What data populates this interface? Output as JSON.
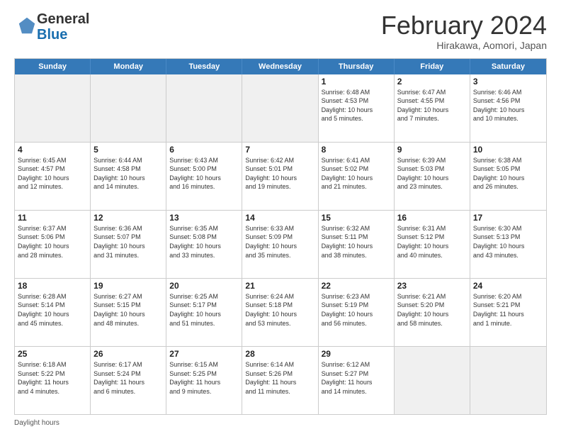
{
  "header": {
    "logo_line1": "General",
    "logo_line2": "Blue",
    "month_title": "February 2024",
    "subtitle": "Hirakawa, Aomori, Japan"
  },
  "day_names": [
    "Sunday",
    "Monday",
    "Tuesday",
    "Wednesday",
    "Thursday",
    "Friday",
    "Saturday"
  ],
  "rows": [
    [
      {
        "day": "",
        "info": "",
        "shaded": true
      },
      {
        "day": "",
        "info": "",
        "shaded": true
      },
      {
        "day": "",
        "info": "",
        "shaded": true
      },
      {
        "day": "",
        "info": "",
        "shaded": true
      },
      {
        "day": "1",
        "info": "Sunrise: 6:48 AM\nSunset: 4:53 PM\nDaylight: 10 hours\nand 5 minutes."
      },
      {
        "day": "2",
        "info": "Sunrise: 6:47 AM\nSunset: 4:55 PM\nDaylight: 10 hours\nand 7 minutes."
      },
      {
        "day": "3",
        "info": "Sunrise: 6:46 AM\nSunset: 4:56 PM\nDaylight: 10 hours\nand 10 minutes."
      }
    ],
    [
      {
        "day": "4",
        "info": "Sunrise: 6:45 AM\nSunset: 4:57 PM\nDaylight: 10 hours\nand 12 minutes."
      },
      {
        "day": "5",
        "info": "Sunrise: 6:44 AM\nSunset: 4:58 PM\nDaylight: 10 hours\nand 14 minutes."
      },
      {
        "day": "6",
        "info": "Sunrise: 6:43 AM\nSunset: 5:00 PM\nDaylight: 10 hours\nand 16 minutes."
      },
      {
        "day": "7",
        "info": "Sunrise: 6:42 AM\nSunset: 5:01 PM\nDaylight: 10 hours\nand 19 minutes."
      },
      {
        "day": "8",
        "info": "Sunrise: 6:41 AM\nSunset: 5:02 PM\nDaylight: 10 hours\nand 21 minutes."
      },
      {
        "day": "9",
        "info": "Sunrise: 6:39 AM\nSunset: 5:03 PM\nDaylight: 10 hours\nand 23 minutes."
      },
      {
        "day": "10",
        "info": "Sunrise: 6:38 AM\nSunset: 5:05 PM\nDaylight: 10 hours\nand 26 minutes."
      }
    ],
    [
      {
        "day": "11",
        "info": "Sunrise: 6:37 AM\nSunset: 5:06 PM\nDaylight: 10 hours\nand 28 minutes."
      },
      {
        "day": "12",
        "info": "Sunrise: 6:36 AM\nSunset: 5:07 PM\nDaylight: 10 hours\nand 31 minutes."
      },
      {
        "day": "13",
        "info": "Sunrise: 6:35 AM\nSunset: 5:08 PM\nDaylight: 10 hours\nand 33 minutes."
      },
      {
        "day": "14",
        "info": "Sunrise: 6:33 AM\nSunset: 5:09 PM\nDaylight: 10 hours\nand 35 minutes."
      },
      {
        "day": "15",
        "info": "Sunrise: 6:32 AM\nSunset: 5:11 PM\nDaylight: 10 hours\nand 38 minutes."
      },
      {
        "day": "16",
        "info": "Sunrise: 6:31 AM\nSunset: 5:12 PM\nDaylight: 10 hours\nand 40 minutes."
      },
      {
        "day": "17",
        "info": "Sunrise: 6:30 AM\nSunset: 5:13 PM\nDaylight: 10 hours\nand 43 minutes."
      }
    ],
    [
      {
        "day": "18",
        "info": "Sunrise: 6:28 AM\nSunset: 5:14 PM\nDaylight: 10 hours\nand 45 minutes."
      },
      {
        "day": "19",
        "info": "Sunrise: 6:27 AM\nSunset: 5:15 PM\nDaylight: 10 hours\nand 48 minutes."
      },
      {
        "day": "20",
        "info": "Sunrise: 6:25 AM\nSunset: 5:17 PM\nDaylight: 10 hours\nand 51 minutes."
      },
      {
        "day": "21",
        "info": "Sunrise: 6:24 AM\nSunset: 5:18 PM\nDaylight: 10 hours\nand 53 minutes."
      },
      {
        "day": "22",
        "info": "Sunrise: 6:23 AM\nSunset: 5:19 PM\nDaylight: 10 hours\nand 56 minutes."
      },
      {
        "day": "23",
        "info": "Sunrise: 6:21 AM\nSunset: 5:20 PM\nDaylight: 10 hours\nand 58 minutes."
      },
      {
        "day": "24",
        "info": "Sunrise: 6:20 AM\nSunset: 5:21 PM\nDaylight: 11 hours\nand 1 minute."
      }
    ],
    [
      {
        "day": "25",
        "info": "Sunrise: 6:18 AM\nSunset: 5:22 PM\nDaylight: 11 hours\nand 4 minutes."
      },
      {
        "day": "26",
        "info": "Sunrise: 6:17 AM\nSunset: 5:24 PM\nDaylight: 11 hours\nand 6 minutes."
      },
      {
        "day": "27",
        "info": "Sunrise: 6:15 AM\nSunset: 5:25 PM\nDaylight: 11 hours\nand 9 minutes."
      },
      {
        "day": "28",
        "info": "Sunrise: 6:14 AM\nSunset: 5:26 PM\nDaylight: 11 hours\nand 11 minutes."
      },
      {
        "day": "29",
        "info": "Sunrise: 6:12 AM\nSunset: 5:27 PM\nDaylight: 11 hours\nand 14 minutes."
      },
      {
        "day": "",
        "info": "",
        "shaded": true
      },
      {
        "day": "",
        "info": "",
        "shaded": true
      }
    ]
  ],
  "footer": {
    "label": "Daylight hours"
  }
}
